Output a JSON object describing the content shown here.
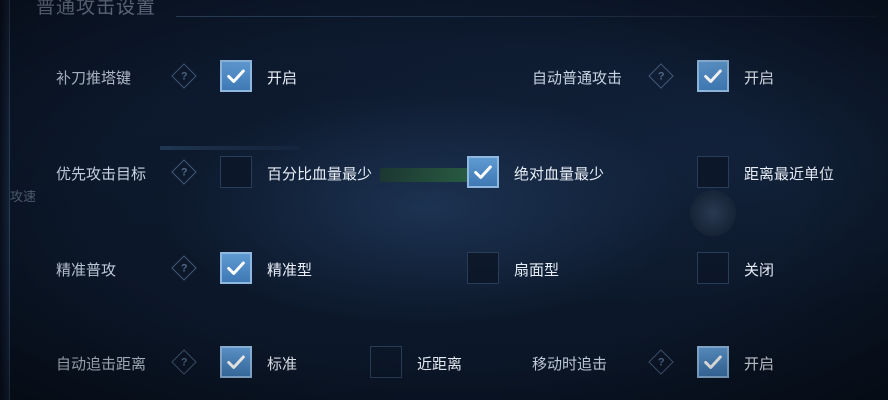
{
  "screen": {
    "title": "普通攻击设置",
    "ghost_text": "攻速"
  },
  "rows": {
    "r1": {
      "left": {
        "label": "补刀推塔键",
        "option": {
          "label": "开启",
          "checked": true
        }
      },
      "right": {
        "label": "自动普通攻击",
        "option": {
          "label": "开启",
          "checked": true
        }
      }
    },
    "r2": {
      "label": "优先攻击目标",
      "options": [
        {
          "label": "百分比血量最少",
          "checked": false
        },
        {
          "label": "绝对血量最少",
          "checked": true
        },
        {
          "label": "距离最近单位",
          "checked": false
        }
      ]
    },
    "r3": {
      "label": "精准普攻",
      "options": [
        {
          "label": "精准型",
          "checked": true
        },
        {
          "label": "扇面型",
          "checked": false
        },
        {
          "label": "关闭",
          "checked": false
        }
      ]
    },
    "r4": {
      "left": {
        "label": "自动追击距离",
        "options": [
          {
            "label": "标准",
            "checked": true
          },
          {
            "label": "近距离",
            "checked": false
          }
        ]
      },
      "right": {
        "label": "移动时追击",
        "option": {
          "label": "开启",
          "checked": true
        }
      }
    }
  },
  "help_glyph": "?",
  "colors": {
    "checked_fill": "#4f8ac4",
    "checked_border": "#8fb8e0",
    "unchecked_fill": "#0c1628"
  }
}
